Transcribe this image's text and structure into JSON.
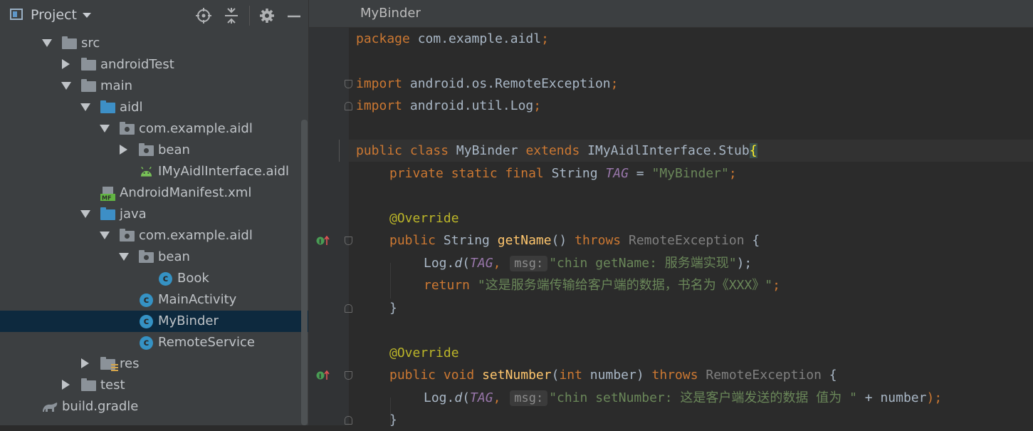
{
  "panel": {
    "title": "Project",
    "header_icons": [
      "locate-icon",
      "collapse-all-icon",
      "gear-icon",
      "minimize-icon"
    ]
  },
  "tree": [
    {
      "label": "src",
      "icon": "folder-icon",
      "expanded": true
    },
    {
      "label": "androidTest",
      "icon": "folder-icon",
      "expanded": false
    },
    {
      "label": "main",
      "icon": "folder-icon",
      "expanded": true
    },
    {
      "label": "aidl",
      "icon": "source-folder-icon",
      "expanded": true
    },
    {
      "label": "com.example.aidl",
      "icon": "package-icon",
      "expanded": true
    },
    {
      "label": "bean",
      "icon": "package-icon",
      "expanded": false
    },
    {
      "label": "IMyAidlInterface.aidl",
      "icon": "android-icon"
    },
    {
      "label": "AndroidManifest.xml",
      "icon": "manifest-icon"
    },
    {
      "label": "java",
      "icon": "source-folder-icon",
      "expanded": true
    },
    {
      "label": "com.example.aidl",
      "icon": "package-icon",
      "expanded": true
    },
    {
      "label": "bean",
      "icon": "package-icon",
      "expanded": true
    },
    {
      "label": "Book",
      "icon": "class-icon"
    },
    {
      "label": "MainActivity",
      "icon": "class-icon"
    },
    {
      "label": "MyBinder",
      "icon": "class-icon",
      "selected": true
    },
    {
      "label": "RemoteService",
      "icon": "class-icon"
    },
    {
      "label": "res",
      "icon": "resource-folder-icon",
      "expanded": false
    },
    {
      "label": "test",
      "icon": "folder-icon",
      "expanded": false
    },
    {
      "label": "build.gradle",
      "icon": "gradle-icon"
    }
  ],
  "editor": {
    "tab_title": "MyBinder",
    "code": {
      "l1_kw": "package",
      "l1_rest": " com.example.aidl",
      "semi": ";",
      "l3_kw": "import",
      "l3_rest": " android.os.RemoteException",
      "l4_rest": " android.util.Log",
      "l6_public": "public",
      "l6_class": " class",
      "l6_name": " MyBinder",
      "l6_extends": " extends",
      "l6_super": " IMyAidlInterface.Stub",
      "open_brace": "{",
      "l7_mods": "private static final",
      "l7_type": " String ",
      "l7_tag": "TAG",
      "l7_eq": " = ",
      "l7_str": "\"MyBinder\"",
      "override": "@Override",
      "m1_public": "public",
      "m1_type": " String ",
      "m1_name": "getName",
      "m1_parens": "() ",
      "throws": "throws",
      "exc": " RemoteException",
      "brace_sp": " {",
      "log": "Log.",
      "log_d": "d",
      "lparen": "(",
      "tag": "TAG",
      "comma": ", ",
      "hint_msg": "msg:",
      "m1_log_str": "\"chin getName: 服务端实现\"",
      "rparen_semi": ");",
      "return_kw": "return",
      "m1_return_str": " \"这是服务端传输给客户端的数据，书名为《XXX》\"",
      "close_brace": "}",
      "m2_void": " void ",
      "m2_name": "setNumber",
      "m2_int": "int",
      "m2_param": " number) ",
      "m2_log_str": "\"chin setNumber: 这是客户端发送的数据 值为 \"",
      "m2_concat": " + number",
      "m2_close": ");"
    }
  }
}
